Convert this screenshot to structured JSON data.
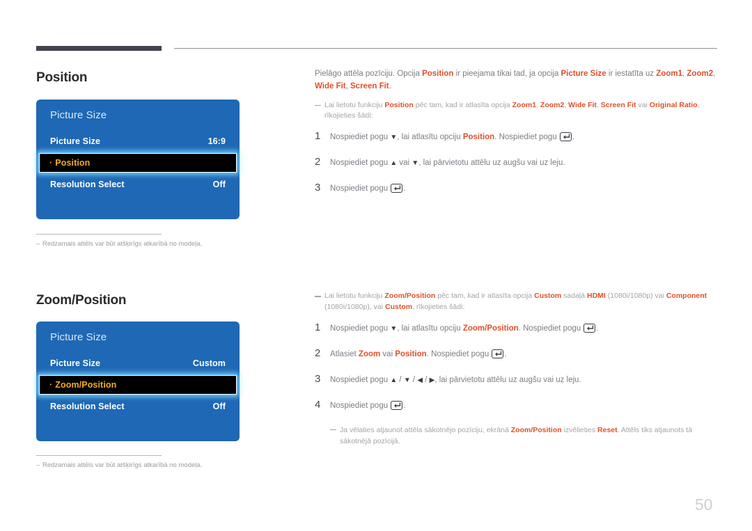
{
  "page": {
    "number": "50"
  },
  "sections": [
    {
      "id": "position",
      "title": "Position",
      "osd": {
        "title": "Picture Size",
        "rows": [
          {
            "label": "Picture Size",
            "value": "16:9",
            "selected": false,
            "bullet": ""
          },
          {
            "label": "Position",
            "value": "",
            "selected": true,
            "bullet": "·"
          },
          {
            "label": "Resolution Select",
            "value": "Off",
            "selected": false,
            "bullet": ""
          }
        ]
      },
      "footnote": "Redzamais attēls var būt atšķirīgs atkarībā no modeļa.",
      "footnote_dash": "–",
      "intro_parts": [
        {
          "t": "Pielāgo attēla pozīciju. Opcija ",
          "k": false
        },
        {
          "t": "Position",
          "k": true
        },
        {
          "t": " ir pieejama tikai tad, ja opcija ",
          "k": false
        },
        {
          "t": "Picture Size",
          "k": true
        },
        {
          "t": " ir iestatīta uz ",
          "k": false
        },
        {
          "t": "Zoom1",
          "k": true
        },
        {
          "t": ", ",
          "k": false
        },
        {
          "t": "Zoom2",
          "k": true
        },
        {
          "t": ", ",
          "k": false
        },
        {
          "t": "Wide Fit",
          "k": true
        },
        {
          "t": ", ",
          "k": false
        },
        {
          "t": "Screen Fit",
          "k": true
        },
        {
          "t": ".",
          "k": false
        }
      ],
      "note_parts": [
        {
          "t": "Lai lietotu funkciju ",
          "k": false
        },
        {
          "t": "Position",
          "k": true
        },
        {
          "t": " pēc tam, kad ir atlasīta opcija ",
          "k": false
        },
        {
          "t": "Zoom1",
          "k": true
        },
        {
          "t": ", ",
          "k": false
        },
        {
          "t": "Zoom2",
          "k": true
        },
        {
          "t": ", ",
          "k": false
        },
        {
          "t": "Wide Fit",
          "k": true
        },
        {
          "t": ", ",
          "k": false
        },
        {
          "t": "Screen Fit",
          "k": true
        },
        {
          "t": " vai ",
          "k": false
        },
        {
          "t": "Original Ratio",
          "k": true
        },
        {
          "t": ", rīkojieties šādi:",
          "k": false
        }
      ],
      "steps": [
        {
          "num": "1",
          "parts": [
            {
              "t": "Nospiediet pogu ",
              "k": false
            },
            {
              "t": "▼",
              "arrow": true
            },
            {
              "t": ", lai atlasītu opciju ",
              "k": false
            },
            {
              "t": "Position",
              "k": true
            },
            {
              "t": ". Nospiediet pogu ",
              "k": false
            },
            {
              "enter": true
            },
            {
              "t": ".",
              "k": false
            }
          ]
        },
        {
          "num": "2",
          "parts": [
            {
              "t": "Nospiediet pogu ",
              "k": false
            },
            {
              "t": "▲",
              "arrow": true
            },
            {
              "t": " vai ",
              "k": false
            },
            {
              "t": "▼",
              "arrow": true
            },
            {
              "t": ", lai pārvietotu attēlu uz augšu vai uz leju.",
              "k": false
            }
          ]
        },
        {
          "num": "3",
          "parts": [
            {
              "t": "Nospiediet pogu ",
              "k": false
            },
            {
              "enter": true
            },
            {
              "t": ".",
              "k": false
            }
          ]
        }
      ],
      "sub_note_parts": []
    },
    {
      "id": "zoom-position",
      "title": "Zoom/Position",
      "osd": {
        "title": "Picture Size",
        "rows": [
          {
            "label": "Picture Size",
            "value": "Custom",
            "selected": false,
            "bullet": ""
          },
          {
            "label": "Zoom/Position",
            "value": "",
            "selected": true,
            "bullet": "·"
          },
          {
            "label": "Resolution Select",
            "value": "Off",
            "selected": false,
            "bullet": ""
          }
        ]
      },
      "footnote": "Redzamais attēls var būt atšķirīgs atkarībā no modeļa.",
      "footnote_dash": "–",
      "intro_parts": [],
      "note_parts": [
        {
          "t": "Lai lietotu funkciju ",
          "k": false
        },
        {
          "t": "Zoom/Position",
          "k": true
        },
        {
          "t": " pēc tam, kad ir atlasīta opcija ",
          "k": false
        },
        {
          "t": "Custom",
          "k": true
        },
        {
          "t": " sadaļā ",
          "k": false
        },
        {
          "t": "HDMI",
          "k": true
        },
        {
          "t": " (1080i/1080p) vai ",
          "k": false
        },
        {
          "t": "Component",
          "k": true
        },
        {
          "t": " (1080i/1080p), vai ",
          "k": false
        },
        {
          "t": "Custom",
          "k": true
        },
        {
          "t": ", rīkojieties šādi:",
          "k": false
        }
      ],
      "steps": [
        {
          "num": "1",
          "parts": [
            {
              "t": "Nospiediet pogu ",
              "k": false
            },
            {
              "t": "▼",
              "arrow": true
            },
            {
              "t": ", lai atlasītu opciju ",
              "k": false
            },
            {
              "t": "Zoom/Position",
              "k": true
            },
            {
              "t": ". Nospiediet pogu ",
              "k": false
            },
            {
              "enter": true
            },
            {
              "t": ".",
              "k": false
            }
          ]
        },
        {
          "num": "2",
          "parts": [
            {
              "t": "Atlasiet ",
              "k": false
            },
            {
              "t": "Zoom",
              "k": true
            },
            {
              "t": " vai ",
              "k": false
            },
            {
              "t": "Position",
              "k": true
            },
            {
              "t": ". Nospiediet pogu ",
              "k": false
            },
            {
              "enter": true
            },
            {
              "t": ".",
              "k": false
            }
          ]
        },
        {
          "num": "3",
          "parts": [
            {
              "t": "Nospiediet pogu ",
              "k": false
            },
            {
              "t": "▲",
              "arrow": true
            },
            {
              "t": " / ",
              "k": false
            },
            {
              "t": "▼",
              "arrow": true
            },
            {
              "t": " / ",
              "k": false
            },
            {
              "t": "◀",
              "arrow": true
            },
            {
              "t": " / ",
              "k": false
            },
            {
              "t": "▶",
              "arrow": true
            },
            {
              "t": ", lai pārvietotu attēlu uz augšu vai uz leju.",
              "k": false
            }
          ]
        },
        {
          "num": "4",
          "parts": [
            {
              "t": "Nospiediet pogu ",
              "k": false
            },
            {
              "enter": true
            },
            {
              "t": ".",
              "k": false
            }
          ]
        }
      ],
      "sub_note_parts": [
        {
          "t": "Ja vēlaties atjaunot attēla sākotnējo pozīciju, ekrānā ",
          "k": false
        },
        {
          "t": "Zoom/Position",
          "k": true
        },
        {
          "t": " izvēlieties ",
          "k": false
        },
        {
          "t": "Reset",
          "k": true
        },
        {
          "t": ". Attēls tiks atjaunots tā sākotnējā pozīcijā.",
          "k": false
        }
      ]
    }
  ],
  "colors": {
    "osd_blue": "#1f68b5",
    "accent_orange": "#e0502b",
    "selected_text": "#f5ad20",
    "rule_dark": "#46414e",
    "body_gray": "#7d7d85"
  }
}
